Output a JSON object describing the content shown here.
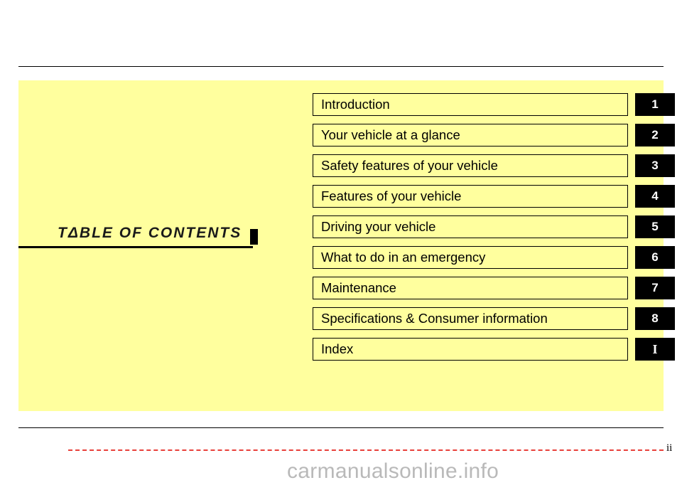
{
  "document": {
    "heading": "TΔBLE  OF  CONTENTS",
    "page_number": "ii",
    "watermark": "carmanualsonline.info"
  },
  "contents": {
    "rows": [
      {
        "label": "Introduction",
        "number": "1"
      },
      {
        "label": "Your vehicle at a glance",
        "number": "2"
      },
      {
        "label": "Safety features of your vehicle",
        "number": "3"
      },
      {
        "label": "Features of your vehicle",
        "number": "4"
      },
      {
        "label": "Driving your vehicle",
        "number": "5"
      },
      {
        "label": "What to do in an emergency",
        "number": "6"
      },
      {
        "label": "Maintenance",
        "number": "7"
      },
      {
        "label": "Specifications & Consumer information",
        "number": "8"
      },
      {
        "label": "Index",
        "number": "I"
      }
    ]
  },
  "colors": {
    "panel_background": "#ffff9e",
    "tab_background": "#000000",
    "tab_text": "#ffffff",
    "rule": "#000000",
    "footer_dash": "#e8403a",
    "watermark": "#b9b9b9"
  }
}
